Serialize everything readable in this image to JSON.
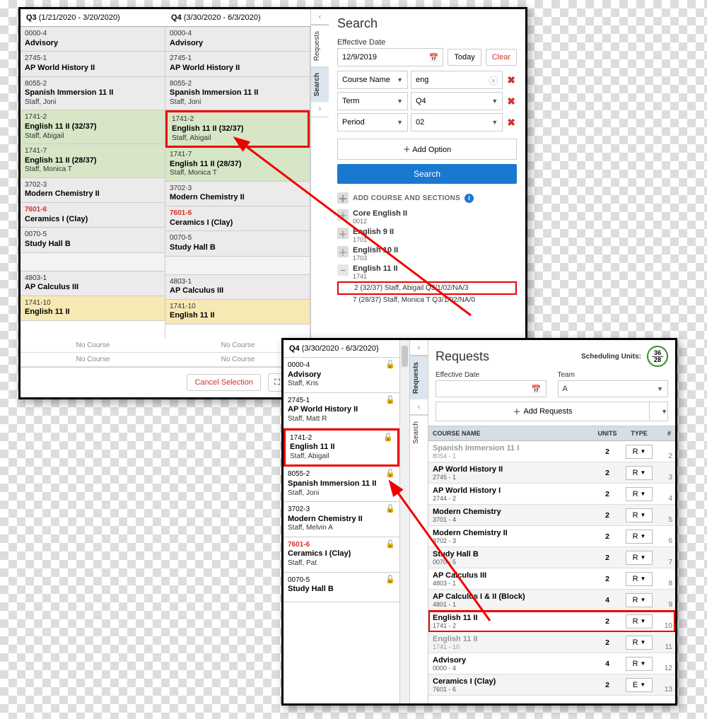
{
  "win1": {
    "q3": {
      "label": "Q3",
      "range": "(1/21/2020 - 3/20/2020)"
    },
    "q4": {
      "label": "Q4",
      "range": "(3/30/2020 - 6/3/2020)"
    },
    "cells_q3": [
      {
        "code": "0000-4",
        "title": "Advisory"
      },
      {
        "code": "2745-1",
        "title": "AP World History II"
      },
      {
        "code": "8055-2",
        "title": "Spanish Immersion 11 II",
        "staff": "Staff, Joni"
      },
      {
        "code": "1741-2",
        "title": "English 11 II (32/37)",
        "staff": "Staff, Abigail",
        "green": true
      },
      {
        "code": "1741-7",
        "title": "English 11 II (28/37)",
        "staff": "Staff, Monica T",
        "green": true
      },
      {
        "code": "3702-3",
        "title": "Modern Chemistry II"
      },
      {
        "code": "7601-6",
        "title": "Ceramics I (Clay)",
        "redcode": true
      },
      {
        "code": "0070-5",
        "title": "Study Hall B"
      },
      {
        "blank": true
      },
      {
        "code": "4803-1",
        "title": "AP Calculus III"
      },
      {
        "code": "1741-10",
        "title": "English 11 II",
        "yellow": true
      }
    ],
    "cells_q4": [
      {
        "code": "0000-4",
        "title": "Advisory"
      },
      {
        "code": "2745-1",
        "title": "AP World History II"
      },
      {
        "code": "8055-2",
        "title": "Spanish Immersion 11 II",
        "staff": "Staff, Joni"
      },
      {
        "code": "1741-2",
        "title": "English 11 II (32/37)",
        "staff": "Staff, Abigail",
        "green": true,
        "highlight": true
      },
      {
        "code": "1741-7",
        "title": "English 11 II (28/37)",
        "staff": "Staff, Monica T",
        "green": true
      },
      {
        "code": "3702-3",
        "title": "Modern Chemistry II"
      },
      {
        "code": "7601-6",
        "title": "Ceramics I (Clay)",
        "redcode": true
      },
      {
        "code": "0070-5",
        "title": "Study Hall B"
      },
      {
        "blank": true
      },
      {
        "code": "4803-1",
        "title": "AP Calculus III"
      },
      {
        "code": "1741-10",
        "title": "English 11 II",
        "yellow": true
      }
    ],
    "no_course": "No Course",
    "footer": {
      "cancel": "Cancel Selection"
    },
    "tabs": {
      "requests": "Requests",
      "search": "Search"
    },
    "search": {
      "title": "Search",
      "eff_label": "Effective Date",
      "eff_value": "12/9/2019",
      "today": "Today",
      "clear": "Clear",
      "filters": [
        {
          "field": "Course Name",
          "value": "eng",
          "xgrey": true
        },
        {
          "field": "Term",
          "value": "Q4"
        },
        {
          "field": "Period",
          "value": "02"
        }
      ],
      "add_option": "Add Option",
      "search_btn": "Search",
      "add_head": "ADD COURSE AND SECTIONS",
      "courses": [
        {
          "name": "Core English II",
          "num": "0012",
          "icon": "plus"
        },
        {
          "name": "English 9 II",
          "num": "1701",
          "icon": "plus"
        },
        {
          "name": "English 10 II",
          "num": "1703",
          "icon": "plus"
        },
        {
          "name": "English 11 II",
          "num": "1741",
          "icon": "minus",
          "sections": [
            {
              "text": "2 (32/37) Staff, Abigail  Q3/1/02/NA/3",
              "hl": true
            },
            {
              "text": "7 (28/37) Staff, Monica T  Q3/1/02/NA/0"
            }
          ]
        }
      ]
    }
  },
  "win2": {
    "q4": {
      "label": "Q4",
      "range": "(3/30/2020 - 6/3/2020)"
    },
    "cells": [
      {
        "code": "0000-4",
        "title": "Advisory",
        "staff": "Staff, Kris"
      },
      {
        "code": "2745-1",
        "title": "AP World History II",
        "staff": "Staff, Matt R"
      },
      {
        "code": "1741-2",
        "title": "English 11 II",
        "staff": "Staff, Abigail",
        "hl": true
      },
      {
        "code": "8055-2",
        "title": "Spanish Immersion 11 II",
        "staff": "Staff, Joni"
      },
      {
        "code": "3702-3",
        "title": "Modern Chemistry II",
        "staff": "Staff, Melvin A"
      },
      {
        "code": "7601-6",
        "title": "Ceramics I (Clay)",
        "staff": "Staff, Pat",
        "redcode": true
      },
      {
        "code": "0070-5",
        "title": "Study Hall B"
      }
    ],
    "tabs": {
      "requests": "Requests",
      "search": "Search"
    },
    "requests": {
      "title": "Requests",
      "sched_label": "Scheduling Units:",
      "units_top": "36",
      "units_bot": "28",
      "eff_label": "Effective Date",
      "team_label": "Team",
      "team_value": "A",
      "add_requests": "Add Requests",
      "head": {
        "name": "COURSE NAME",
        "units": "UNITS",
        "type": "TYPE",
        "num": "#"
      },
      "rows": [
        {
          "name": "Spanish Immersion 11 I",
          "num": "8054 - 1",
          "units": "2",
          "type": "R",
          "idx": "2",
          "fade": true
        },
        {
          "name": "AP World History II",
          "num": "2745 - 1",
          "units": "2",
          "type": "R",
          "idx": "3"
        },
        {
          "name": "AP World History I",
          "num": "2744 - 2",
          "units": "2",
          "type": "R",
          "idx": "4"
        },
        {
          "name": "Modern Chemistry",
          "num": "3701 - 4",
          "units": "2",
          "type": "R",
          "idx": "5"
        },
        {
          "name": "Modern Chemistry II",
          "num": "3702 - 3",
          "units": "2",
          "type": "R",
          "idx": "6"
        },
        {
          "name": "Study Hall B",
          "num": "0070 - 5",
          "units": "2",
          "type": "R",
          "idx": "7"
        },
        {
          "name": "AP Calculus III",
          "num": "4803 - 1",
          "units": "2",
          "type": "R",
          "idx": "8"
        },
        {
          "name": "AP Calculus I & II (Block)",
          "num": "4801 - 1",
          "units": "4",
          "type": "R",
          "idx": "9"
        },
        {
          "name": "English 11 II",
          "num": "1741 - 2",
          "units": "2",
          "type": "R",
          "idx": "10",
          "hl": true
        },
        {
          "name": "English 11 II",
          "num": "1741 - 10",
          "units": "2",
          "type": "R",
          "idx": "11",
          "fade": true
        },
        {
          "name": "Advisory",
          "num": "0000 - 4",
          "units": "4",
          "type": "R",
          "idx": "12"
        },
        {
          "name": "Ceramics I (Clay)",
          "num": "7601 - 6",
          "units": "2",
          "type": "E",
          "idx": "13"
        }
      ]
    }
  }
}
